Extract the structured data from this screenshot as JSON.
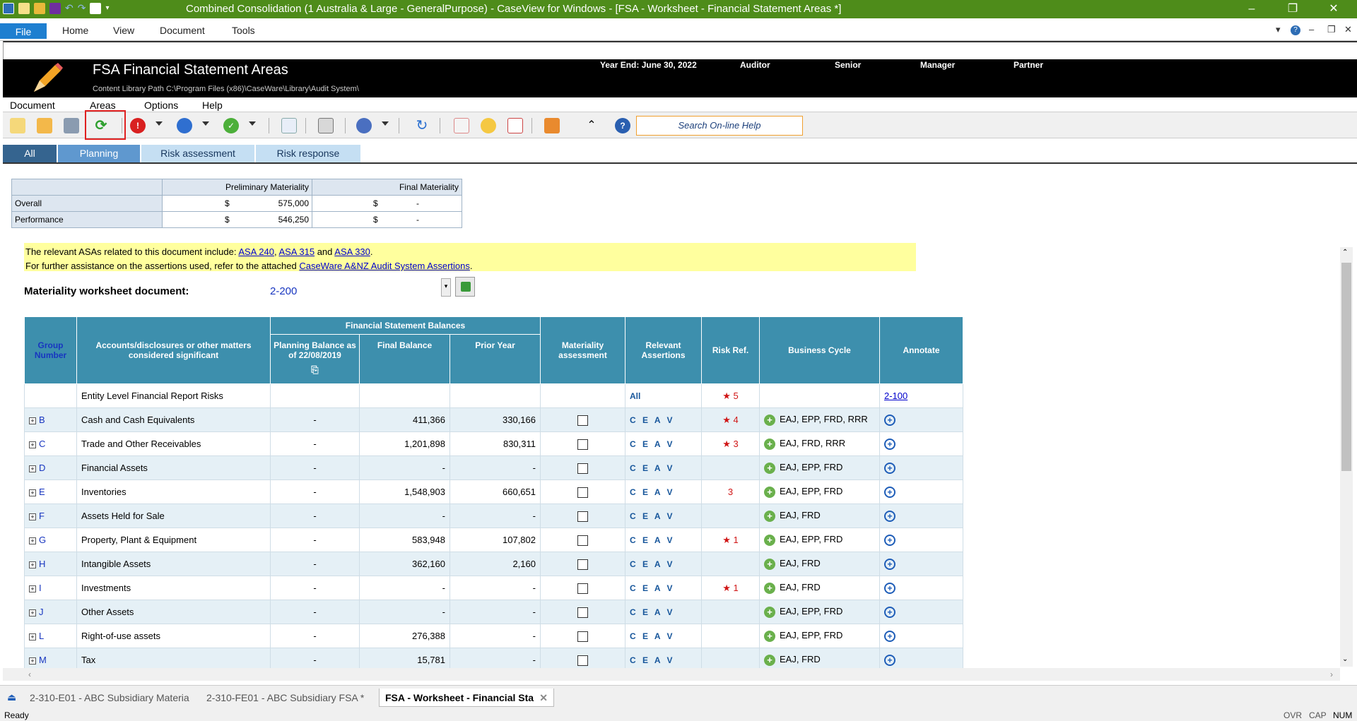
{
  "window": {
    "title": "Combined Consolidation (1 Australia & Large - GeneralPurpose) - CaseView for Windows - [FSA - Worksheet - Financial Statement Areas *]",
    "min": "–",
    "max": "❐",
    "close": "✕",
    "ribbon_tabs": [
      "File",
      "Home",
      "View",
      "Document",
      "Tools"
    ]
  },
  "header": {
    "title": "FSA Financial Statement Areas",
    "path": "Content Library Path  C:\\Program Files (x86)\\CaseWare\\Library\\Audit System\\",
    "year_end": "Year End: June 30, 2022",
    "auditor": "Auditor",
    "senior": "Senior",
    "manager": "Manager",
    "partner": "Partner"
  },
  "menu": [
    "Document",
    "Areas",
    "Options",
    "Help"
  ],
  "toolbar": {
    "search_help": "Search On-line Help"
  },
  "filter_tabs": [
    "All",
    "Planning",
    "Risk assessment",
    "Risk response"
  ],
  "materiality": {
    "col_prelim": "Preliminary Materiality",
    "col_final": "Final Materiality",
    "rows": [
      {
        "label": "Overall",
        "cur": "$",
        "prelim": "575,000",
        "cur2": "$",
        "final": "-"
      },
      {
        "label": "Performance",
        "cur": "$",
        "prelim": "546,250",
        "cur2": "$",
        "final": "-"
      }
    ]
  },
  "asa": {
    "line1_pre": "The relevant ASAs related to this document include: ",
    "link1": "ASA 240",
    "sep1": ", ",
    "link2": "ASA 315",
    "sep2": " and ",
    "link3": "ASA 330",
    "end1": ".",
    "line2_pre": "For further assistance on the assertions used, refer to the attached ",
    "link4": "CaseWare A&NZ Audit System Assertions",
    "end2": "."
  },
  "materiality_doc": {
    "label": "Materiality worksheet document:",
    "value": "2-200"
  },
  "table": {
    "headers": {
      "group": "Group Number",
      "accounts": "Accounts/disclosures or other matters considered significant",
      "fsb": "Financial Statement Balances",
      "planning": "Planning Balance as of 22/08/2019",
      "final": "Final Balance",
      "prior": "Prior Year",
      "materiality": "Materiality assessment",
      "assertions": "Relevant Assertions",
      "risk": "Risk Ref.",
      "cycle": "Business Cycle",
      "annotate": "Annotate"
    },
    "entity_row": {
      "name": "Entity Level Financial Report Risks",
      "assertions": "All",
      "risk": "5",
      "annotate": "2-100"
    },
    "rows": [
      {
        "group": "B",
        "name": "Cash and Cash Equivalents",
        "planning": "-",
        "final": "411,366",
        "prior": "330,166",
        "assertions": "C E A V",
        "risk": "4",
        "star": true,
        "cycle": "EAJ, EPP, FRD, RRR"
      },
      {
        "group": "C",
        "name": "Trade and Other Receivables",
        "planning": "-",
        "final": "1,201,898",
        "prior": "830,311",
        "assertions": "C E A V",
        "risk": "3",
        "star": true,
        "cycle": "EAJ, FRD, RRR"
      },
      {
        "group": "D",
        "name": "Financial Assets",
        "planning": "-",
        "final": "-",
        "prior": "-",
        "assertions": "C E A V",
        "risk": "",
        "star": false,
        "cycle": "EAJ, EPP, FRD"
      },
      {
        "group": "E",
        "name": "Inventories",
        "planning": "-",
        "final": "1,548,903",
        "prior": "660,651",
        "assertions": "C E A V",
        "risk": "3",
        "star": false,
        "cycle": "EAJ, EPP, FRD"
      },
      {
        "group": "F",
        "name": "Assets Held for Sale",
        "planning": "-",
        "final": "-",
        "prior": "-",
        "assertions": "C E A V",
        "risk": "",
        "star": false,
        "cycle": "EAJ, FRD"
      },
      {
        "group": "G",
        "name": "Property, Plant & Equipment",
        "planning": "-",
        "final": "583,948",
        "prior": "107,802",
        "assertions": "C E A V",
        "risk": "1",
        "star": true,
        "cycle": "EAJ, EPP, FRD"
      },
      {
        "group": "H",
        "name": "Intangible Assets",
        "planning": "-",
        "final": "362,160",
        "prior": "2,160",
        "assertions": "C E A V",
        "risk": "",
        "star": false,
        "cycle": "EAJ, FRD"
      },
      {
        "group": "I",
        "name": "Investments",
        "planning": "-",
        "final": "-",
        "prior": "-",
        "assertions": "C E A V",
        "risk": "1",
        "star": true,
        "cycle": "EAJ, FRD"
      },
      {
        "group": "J",
        "name": "Other Assets",
        "planning": "-",
        "final": "-",
        "prior": "-",
        "assertions": "C E A V",
        "risk": "",
        "star": false,
        "cycle": "EAJ, EPP, FRD"
      },
      {
        "group": "L",
        "name": "Right-of-use assets",
        "planning": "-",
        "final": "276,388",
        "prior": "-",
        "assertions": "C E A V",
        "risk": "",
        "star": false,
        "cycle": "EAJ, EPP, FRD"
      },
      {
        "group": "M",
        "name": "Tax",
        "planning": "-",
        "final": "15,781",
        "prior": "-",
        "assertions": "C E A V",
        "risk": "",
        "star": false,
        "cycle": "EAJ, FRD"
      }
    ]
  },
  "doc_tabs": [
    {
      "label": "2-310-E01 - ABC Subsidiary Materia"
    },
    {
      "label": "2-310-FE01 - ABC Subsidiary FSA *"
    },
    {
      "label": "FSA - Worksheet - Financial Sta"
    }
  ],
  "status": {
    "ready": "Ready",
    "ovr": "OVR",
    "cap": "CAP",
    "num": "NUM"
  }
}
